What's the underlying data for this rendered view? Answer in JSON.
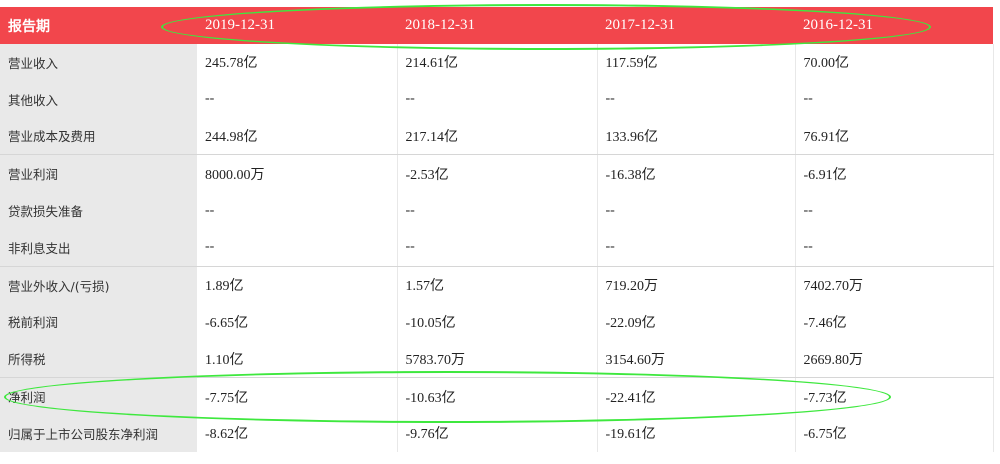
{
  "table": {
    "header": {
      "label": "报告期",
      "dates": [
        "2019-12-31",
        "2018-12-31",
        "2017-12-31",
        "2016-12-31"
      ]
    },
    "rows": [
      {
        "label": "营业收入",
        "values": [
          "245.78亿",
          "214.61亿",
          "117.59亿",
          "70.00亿"
        ]
      },
      {
        "label": "其他收入",
        "values": [
          "--",
          "--",
          "--",
          "--"
        ]
      },
      {
        "label": "营业成本及费用",
        "values": [
          "244.98亿",
          "217.14亿",
          "133.96亿",
          "76.91亿"
        ]
      },
      {
        "label": "营业利润",
        "values": [
          "8000.00万",
          "-2.53亿",
          "-16.38亿",
          "-6.91亿"
        ]
      },
      {
        "label": "贷款损失准备",
        "values": [
          "--",
          "--",
          "--",
          "--"
        ]
      },
      {
        "label": "非利息支出",
        "values": [
          "--",
          "--",
          "--",
          "--"
        ]
      },
      {
        "label": "营业外收入/(亏损)",
        "values": [
          "1.89亿",
          "1.57亿",
          "719.20万",
          "7402.70万"
        ]
      },
      {
        "label": "税前利润",
        "values": [
          "-6.65亿",
          "-10.05亿",
          "-22.09亿",
          "-7.46亿"
        ]
      },
      {
        "label": "所得税",
        "values": [
          "1.10亿",
          "5783.70万",
          "3154.60万",
          "2669.80万"
        ]
      },
      {
        "label": "净利润",
        "values": [
          "-7.75亿",
          "-10.63亿",
          "-22.41亿",
          "-7.73亿"
        ]
      },
      {
        "label": "归属于上市公司股东净利润",
        "values": [
          "-8.62亿",
          "-9.76亿",
          "-19.61亿",
          "-6.75亿"
        ]
      }
    ]
  },
  "colors": {
    "header_bg": "#f2464c",
    "label_bg": "#e9e9e9",
    "highlight_ellipse": "#3ee83e"
  }
}
